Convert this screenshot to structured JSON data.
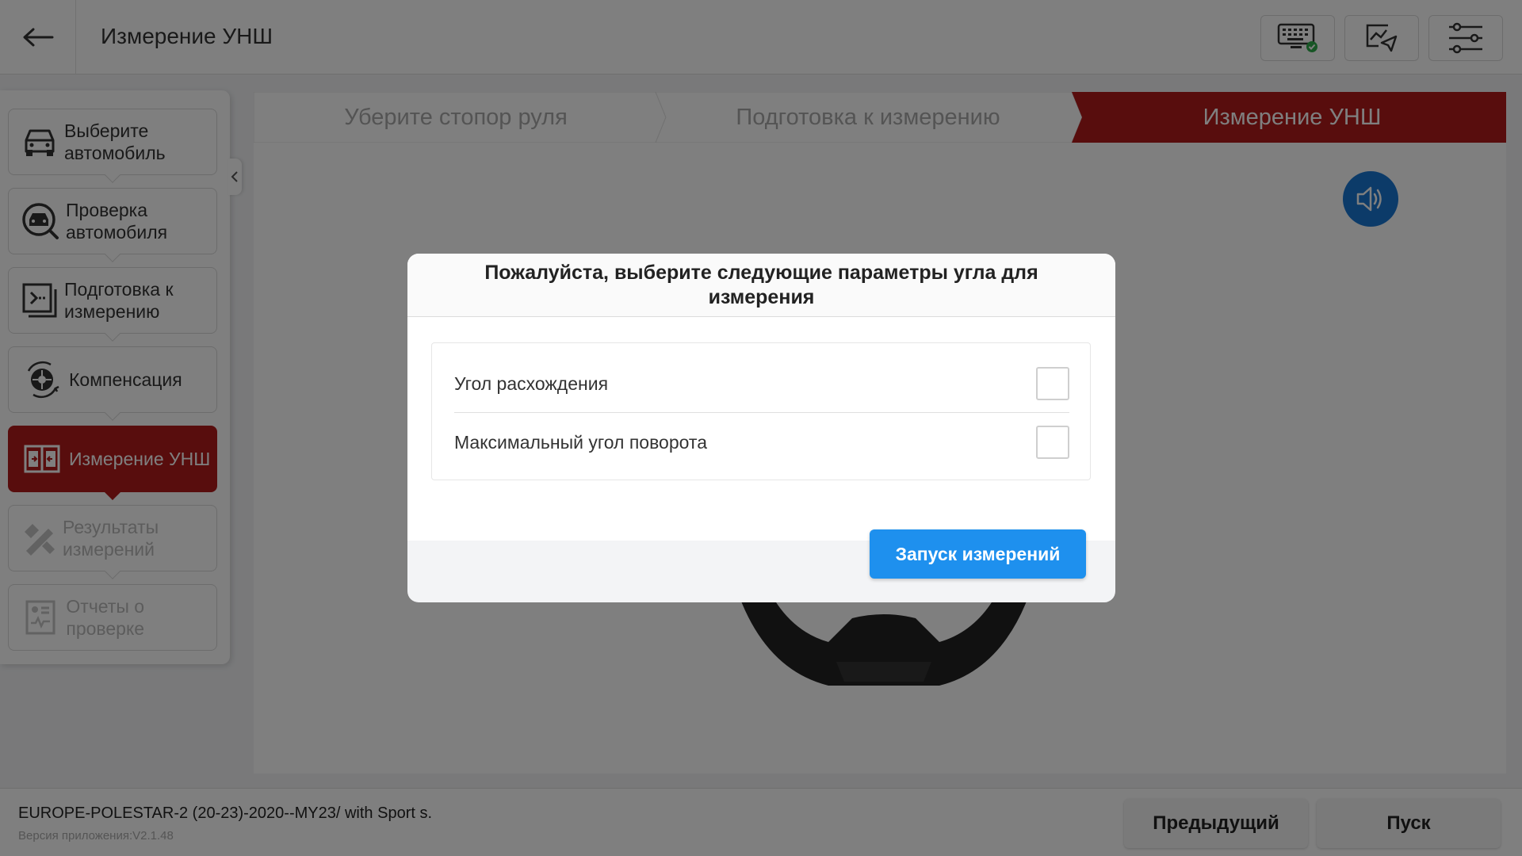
{
  "header": {
    "title": "Измерение УНШ",
    "buttons": [
      "keyboard-check-icon",
      "report-send-icon",
      "settings-sliders-icon"
    ]
  },
  "sidebar": {
    "items": [
      {
        "label": "Выберите автомобиль",
        "icon": "car-icon",
        "state": "normal"
      },
      {
        "label": "Проверка автомобиля",
        "icon": "car-search-icon",
        "state": "normal"
      },
      {
        "label": "Подготовка к измерению",
        "icon": "prepare-icon",
        "state": "normal"
      },
      {
        "label": "Компенсация",
        "icon": "wheel-compensation-icon",
        "state": "normal"
      },
      {
        "label": "Измерение УНШ",
        "icon": "alignment-measure-icon",
        "state": "active"
      },
      {
        "label": "Результаты измерений",
        "icon": "results-icon",
        "state": "disabled"
      },
      {
        "label": "Отчеты о проверке",
        "icon": "report-icon",
        "state": "disabled"
      }
    ]
  },
  "steps": [
    {
      "label": "Уберите стопор руля",
      "state": "done"
    },
    {
      "label": "Подготовка к измерению",
      "state": "done"
    },
    {
      "label": "Измерение УНШ",
      "state": "active"
    }
  ],
  "modal": {
    "title": "Пожалуйста, выберите следующие параметры угла для измерения",
    "options": [
      {
        "label": "Угол расхождения",
        "checked": false
      },
      {
        "label": "Максимальный угол поворота",
        "checked": false
      }
    ],
    "start_button": "Запуск измерений"
  },
  "footer": {
    "vehicle": "EUROPE-POLESTAR-2 (20-23)-2020--MY23/ with Sport s.",
    "version": "Версия приложения:V2.1.48",
    "prev_button": "Предыдущий",
    "start_button": "Пуск"
  },
  "colors": {
    "accent_red": "#b01a1a",
    "primary_blue": "#1e90ee",
    "speaker_blue": "#1976d2"
  }
}
